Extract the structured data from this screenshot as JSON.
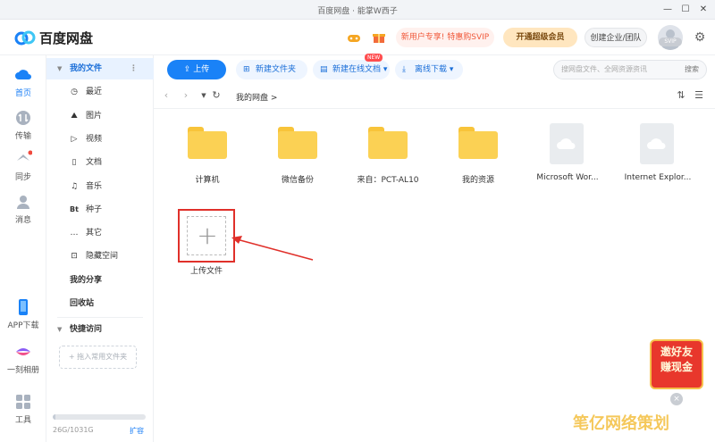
{
  "titlebar": {
    "title": "百度网盘 · 能掌W西子"
  },
  "header": {
    "brand": "百度网盘",
    "promo_pill": "新用户专享! 特惠购SVIP",
    "vip_pill": "开通超级会员",
    "enterprise_pill": "创建企业/团队",
    "avatar_tag": "SVIP"
  },
  "rail": {
    "items": [
      {
        "label": "首页",
        "icon": "cloud-home-icon"
      },
      {
        "label": "传输",
        "icon": "transfer-icon"
      },
      {
        "label": "同步",
        "icon": "sync-icon"
      },
      {
        "label": "消息",
        "icon": "message-icon"
      },
      {
        "label": "APP下载",
        "icon": "phone-icon"
      },
      {
        "label": "一刻相册",
        "icon": "album-icon"
      },
      {
        "label": "工具",
        "icon": "tools-icon"
      }
    ]
  },
  "sidebar": {
    "my_files": "我的文件",
    "sub_items": [
      {
        "label": "最近",
        "icon": "clock-icon"
      },
      {
        "label": "图片",
        "icon": "image-icon"
      },
      {
        "label": "视频",
        "icon": "video-icon"
      },
      {
        "label": "文档",
        "icon": "document-icon"
      },
      {
        "label": "音乐",
        "icon": "music-icon"
      },
      {
        "label": "种子",
        "icon": "bt-icon"
      },
      {
        "label": "其它",
        "icon": "more-dots-icon"
      },
      {
        "label": "隐藏空间",
        "icon": "lock-icon"
      }
    ],
    "my_share": "我的分享",
    "recycle": "回收站",
    "quick_access": "快捷访问",
    "drop_hint": "+ 拖入常用文件夹",
    "quota": "26G/1031G",
    "quota_fraction": 0.025,
    "expand": "扩容"
  },
  "toolbar": {
    "upload": "上传",
    "new_folder": "新建文件夹",
    "new_online_doc": "新建在线文档",
    "new_badge": "NEW",
    "offline_download": "离线下载",
    "search_placeholder": "搜网盘文件、全网资源资讯",
    "search_button": "搜索"
  },
  "pathbar": {
    "crumb": "我的网盘 >"
  },
  "files": [
    {
      "name": "计算机",
      "type": "folder"
    },
    {
      "name": "微信备份",
      "type": "folder"
    },
    {
      "name": "来自：PCT-AL10",
      "type": "folder"
    },
    {
      "name": "我的资源",
      "type": "folder"
    },
    {
      "name": "Microsoft Wor...",
      "type": "cloud"
    },
    {
      "name": "Internet Explor...",
      "type": "cloud"
    }
  ],
  "upload_tile": {
    "label": "上传文件"
  },
  "promo_badge": {
    "line1": "邀好友",
    "line2": "赚现金"
  },
  "watermark": "笔亿网络策划",
  "colors": {
    "accent": "#1a82f7",
    "highlight_red": "#e0302a",
    "folder": "#fbd154"
  }
}
